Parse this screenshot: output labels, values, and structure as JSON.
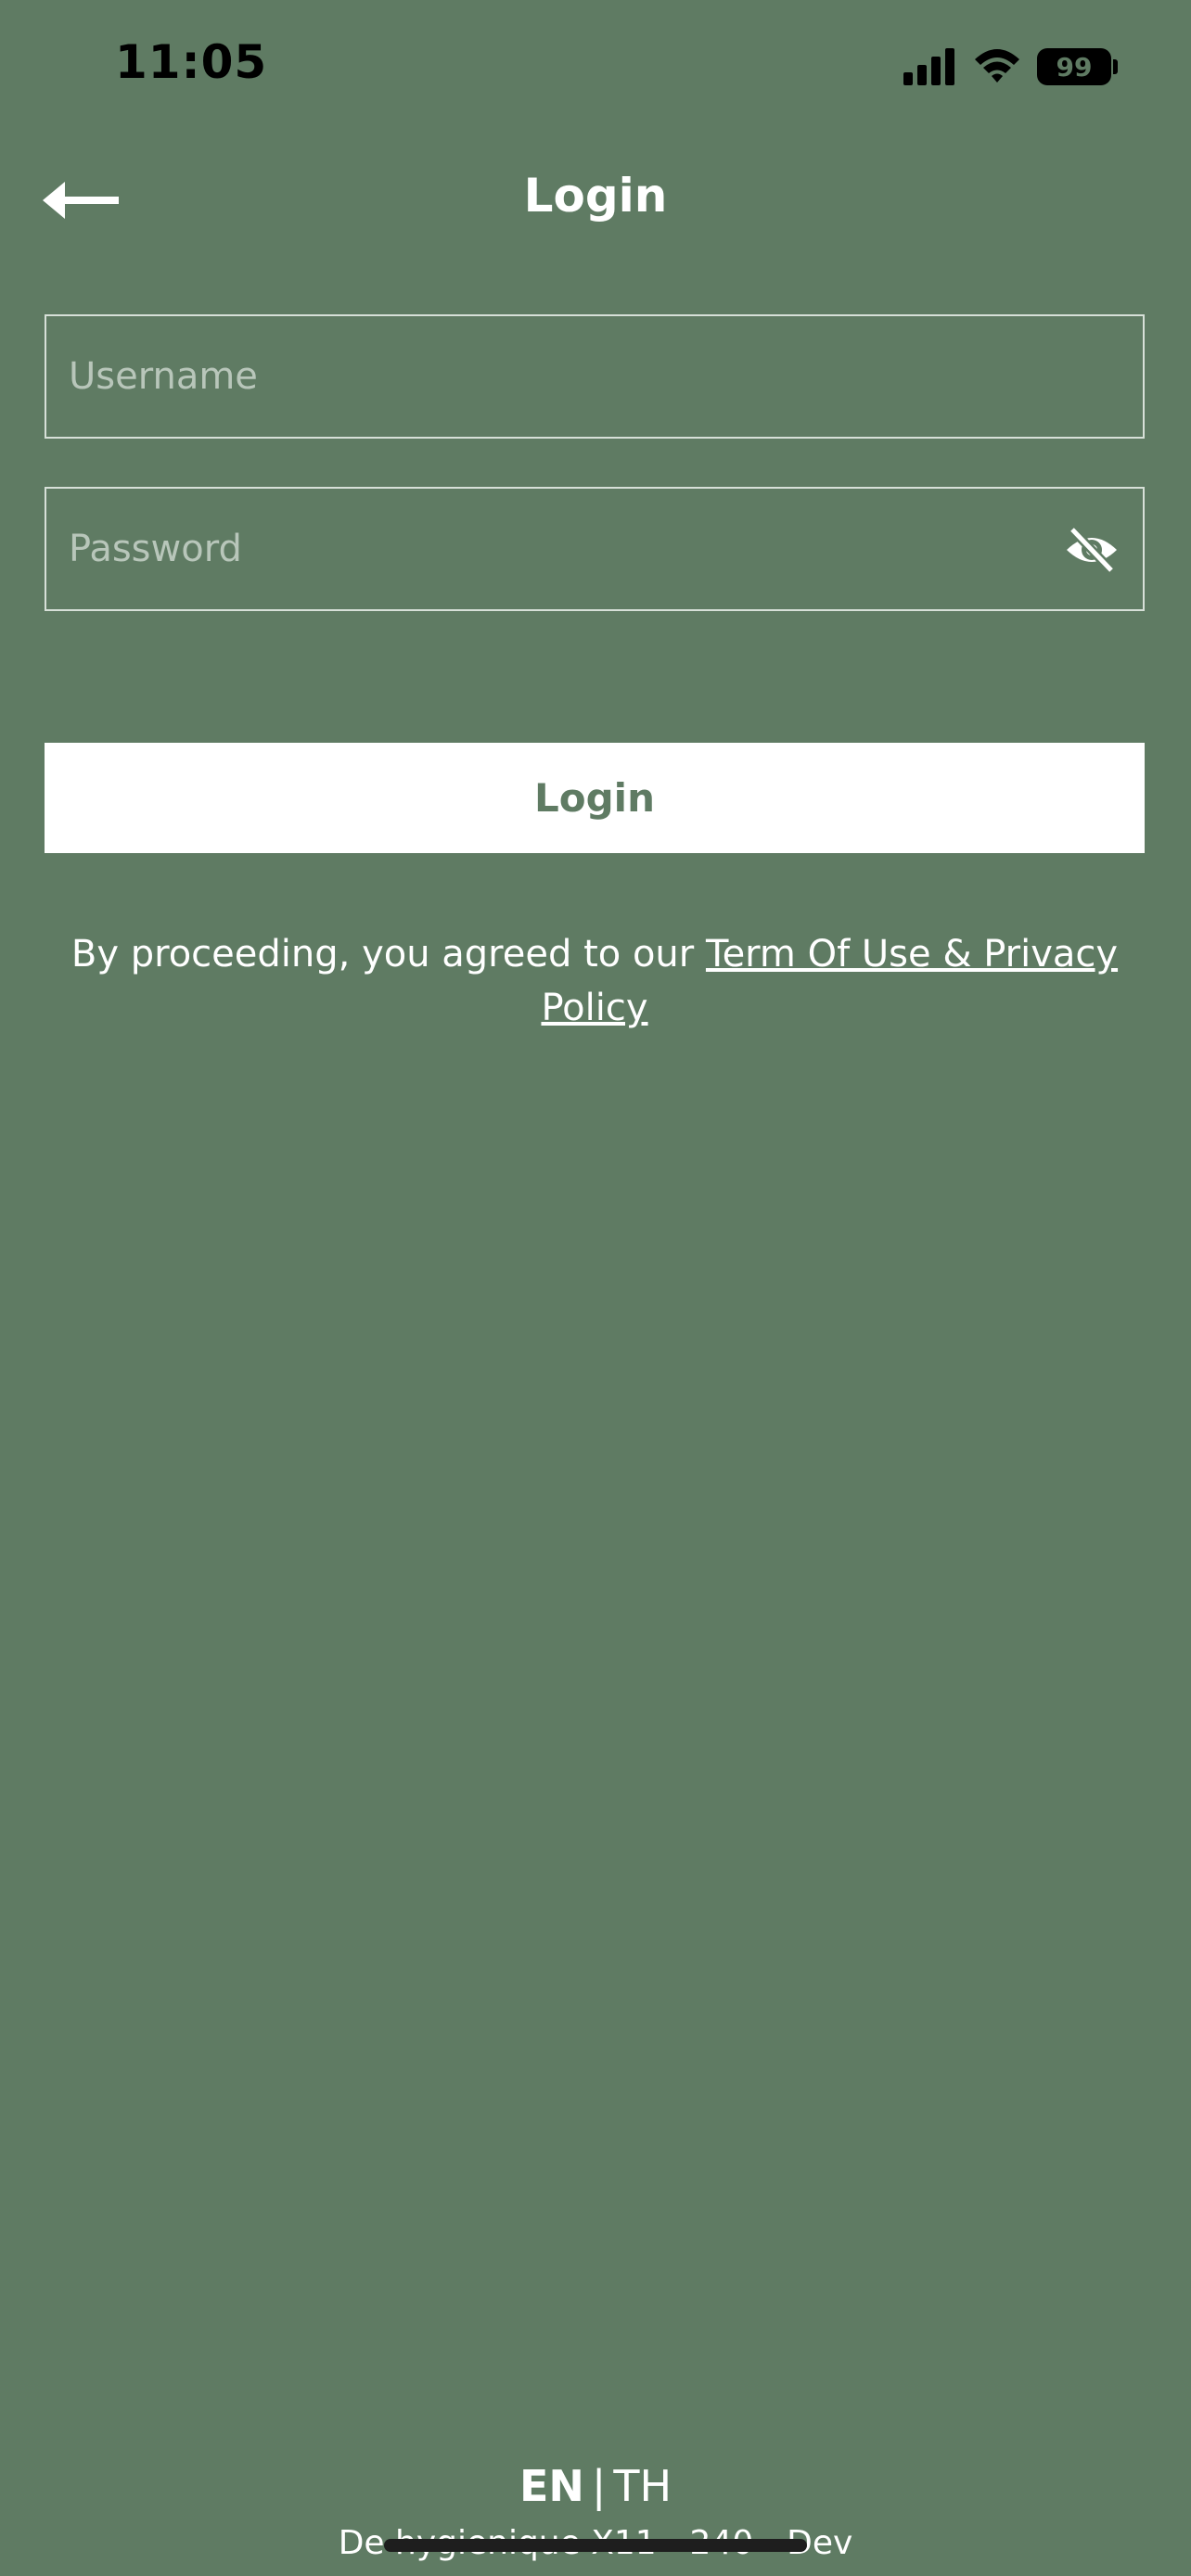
{
  "status_bar": {
    "time": "11:05",
    "battery": "99"
  },
  "header": {
    "title": "Login"
  },
  "form": {
    "username_placeholder": "Username",
    "password_placeholder": "Password",
    "login_label": "Login"
  },
  "terms": {
    "prefix": "By proceeding, you agreed to our",
    "link": "Term Of Use & Privacy Policy"
  },
  "language": {
    "en": "EN",
    "separator": "|",
    "th": "TH"
  },
  "footer": {
    "version": "De hygienique X11 - 240 - Dev"
  },
  "colors": {
    "background": "#5f7b63",
    "button_bg": "#ffffff",
    "accent_text": "#5f7b63"
  },
  "icons": [
    "signal-icon",
    "wifi-icon",
    "battery-icon",
    "back-arrow-icon",
    "eye-off-icon"
  ]
}
